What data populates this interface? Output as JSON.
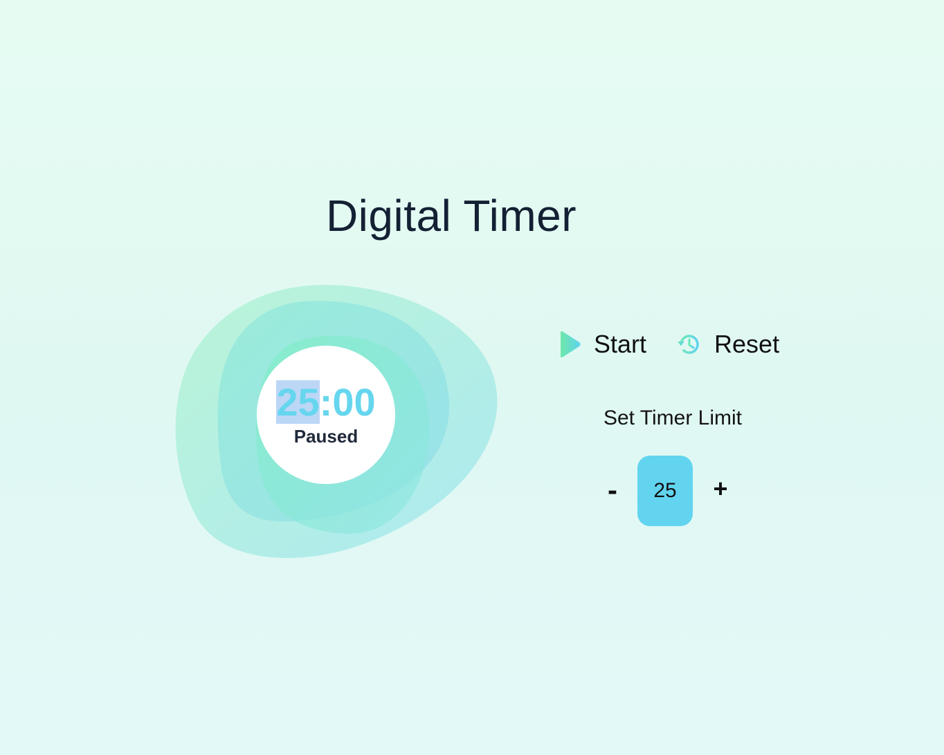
{
  "page": {
    "title": "Digital Timer"
  },
  "timer": {
    "minutes": "25",
    "separator_seconds": ":00",
    "status": "Paused"
  },
  "controls": {
    "start_label": "Start",
    "start_icon": "play-icon",
    "reset_label": "Reset",
    "reset_icon": "history-icon"
  },
  "limit": {
    "title": "Set Timer Limit",
    "decrement_label": "-",
    "value": "25",
    "increment_label": "+"
  },
  "colors": {
    "accent_cyan": "#62d4ef",
    "accent_green": "#6ee7b7",
    "text_dark": "#142033",
    "selection": "#bcd6f6"
  }
}
